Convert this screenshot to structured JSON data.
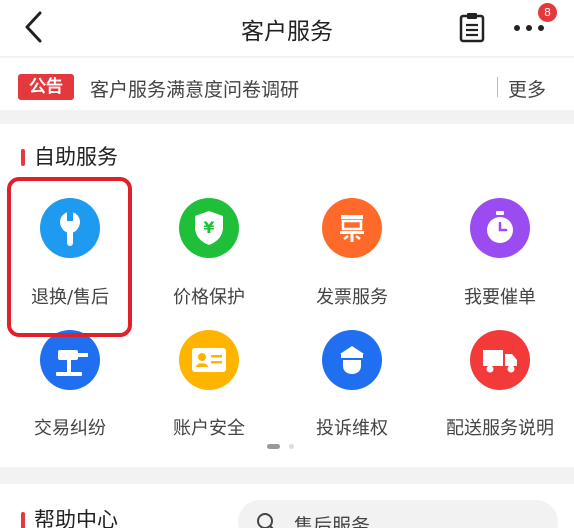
{
  "header": {
    "title": "客户服务",
    "back_icon": "chevron-left-icon",
    "list_icon": "clipboard-icon",
    "more_icon": "more-dots-icon",
    "badge_count": "8"
  },
  "notice": {
    "tag": "公告",
    "text": "客户服务满意度问卷调研",
    "more_label": "更多"
  },
  "self_service": {
    "title": "自助服务",
    "items": [
      {
        "label": "退换/售后",
        "icon": "wrench-icon",
        "color": "#1e9bf0"
      },
      {
        "label": "价格保护",
        "icon": "shield-yen-icon",
        "color": "#1fbf3a"
      },
      {
        "label": "发票服务",
        "icon": "invoice-icon",
        "color": "#ff6a2a"
      },
      {
        "label": "我要催单",
        "icon": "stopwatch-icon",
        "color": "#9b4cf0"
      },
      {
        "label": "交易纠纷",
        "icon": "gavel-icon",
        "color": "#1f6ff0"
      },
      {
        "label": "账户安全",
        "icon": "id-card-icon",
        "color": "#ffb400"
      },
      {
        "label": "投诉维权",
        "icon": "police-icon",
        "color": "#1f6ff0"
      },
      {
        "label": "配送服务说明",
        "icon": "truck-icon",
        "color": "#f23a3a"
      }
    ]
  },
  "help": {
    "title": "帮助中心",
    "search_text": "售后服务",
    "search_icon": "search-icon"
  },
  "colors": {
    "accent": "#e4393c",
    "highlight_box": "#e0202a"
  }
}
